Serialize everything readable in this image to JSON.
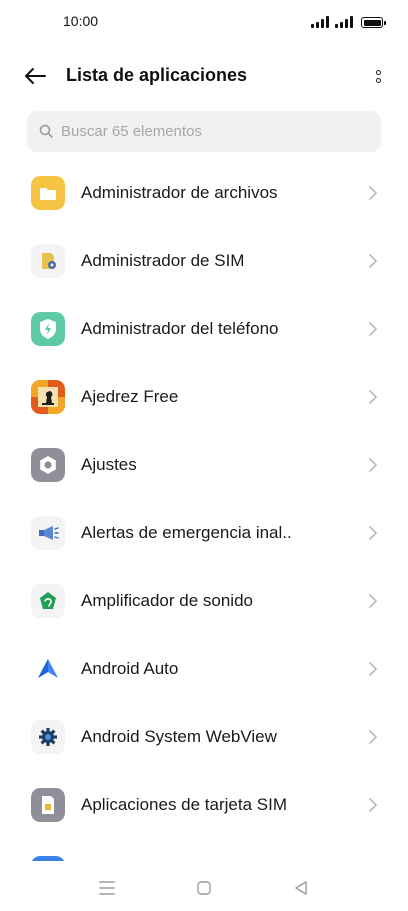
{
  "status_bar": {
    "time": "10:00"
  },
  "header": {
    "title": "Lista de aplicaciones"
  },
  "search": {
    "placeholder": "Buscar 65 elementos"
  },
  "apps": [
    {
      "label": "Administrador de archivos",
      "icon": "folder-icon"
    },
    {
      "label": "Administrador de SIM",
      "icon": "sim-manager-icon"
    },
    {
      "label": "Administrador del teléfono",
      "icon": "phone-manager-shield-icon"
    },
    {
      "label": "Ajedrez Free",
      "icon": "chess-icon"
    },
    {
      "label": "Ajustes",
      "icon": "settings-gear-icon"
    },
    {
      "label": "Alertas de emergencia inal..",
      "icon": "megaphone-icon"
    },
    {
      "label": "Amplificador de sonido",
      "icon": "sound-amplifier-icon"
    },
    {
      "label": "Android Auto",
      "icon": "android-auto-icon"
    },
    {
      "label": "Android System WebView",
      "icon": "webview-gear-icon"
    },
    {
      "label": "Aplicaciones de tarjeta SIM",
      "icon": "sim-card-icon"
    },
    {
      "label": "",
      "icon": "app-icon-partial"
    }
  ],
  "colors": {
    "accent_blue": "#3b82e6",
    "folder_yellow": "#f6c443",
    "shield_green": "#5dc9a6",
    "settings_grey": "#8e8f99",
    "search_bg": "#f1f1f1"
  }
}
